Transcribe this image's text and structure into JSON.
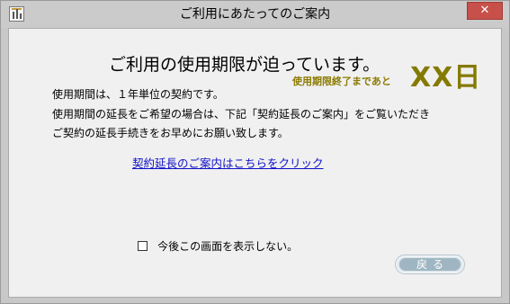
{
  "window": {
    "title": "ご利用にあたってのご案内",
    "icon": "app-icon",
    "close_label": "✕"
  },
  "notice": {
    "headline": "ご利用の使用期限が迫っています。",
    "days_prefix": "使用期限終了まであと",
    "days_value": "XX日",
    "lines": [
      "使用期間は、１年単位の契約です。",
      "使用期間の延長をご希望の場合は、下記「契約延長のご案内」をご覧いただき",
      "ご契約の延長手続きをお早めにお願い致します。"
    ],
    "link_text": "契約延長のご案内はこちらをクリック"
  },
  "options": {
    "dont_show_label": "今後この画面を表示しない。",
    "dont_show_checked": false
  },
  "buttons": {
    "back_label": "戻る"
  },
  "colors": {
    "accent_days": "#857a00",
    "link": "#1010c8",
    "close": "#c7504b"
  }
}
